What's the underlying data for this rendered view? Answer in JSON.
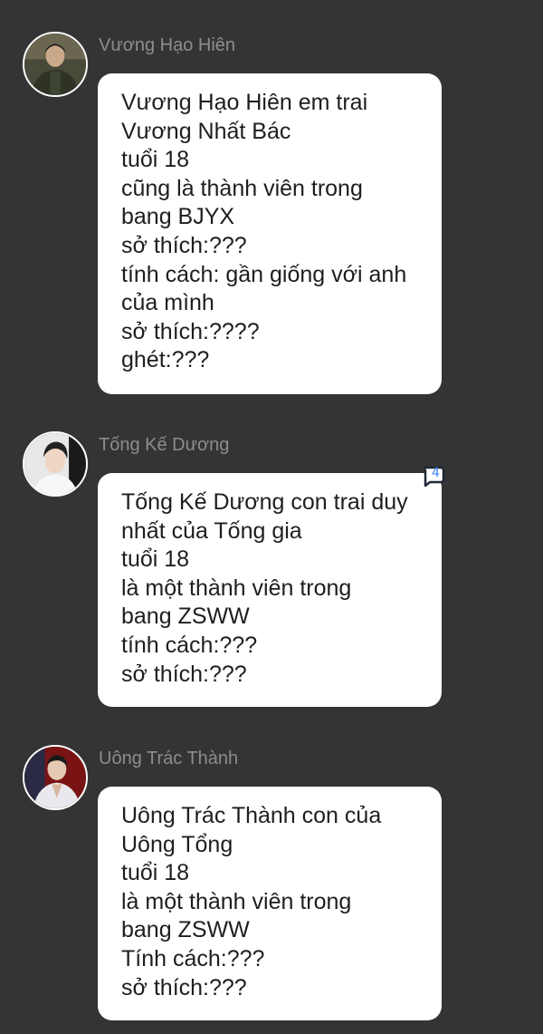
{
  "messages": [
    {
      "sender": "Vương Hạo Hiên",
      "avatar": "avatar-man-in-jacket",
      "lines": [
        "Vương Hạo Hiên em trai",
        "Vương Nhất Bác",
        "tuổi 18",
        "cũng là thành viên trong",
        "bang BJYX",
        "sở thích:???",
        "tính cách: gần giống với anh",
        "của mình",
        "sở thích:????",
        "ghét:???"
      ]
    },
    {
      "sender": "Tống Kế Dương",
      "avatar": "avatar-man-white-shirt",
      "reaction_count": "4",
      "lines": [
        "Tống Kế Dương con trai duy",
        "nhất của Tống gia",
        "tuổi 18",
        "là một thành viên trong",
        "bang ZSWW",
        "tính cách:???",
        "sở thích:???"
      ]
    },
    {
      "sender": "Uông Trác Thành",
      "avatar": "avatar-man-red-background",
      "lines": [
        "Uông Trác Thành con của",
        "Uông Tổng",
        "tuổi 18",
        "là một thành viên trong",
        "bang ZSWW",
        "Tính cách:???",
        "sở thích:???"
      ]
    }
  ],
  "colors": {
    "background": "#343434",
    "bubble": "#ffffff",
    "sender_name": "#8d8d8d",
    "message_text": "#1e1e1e",
    "reaction": "#3b82f6"
  }
}
